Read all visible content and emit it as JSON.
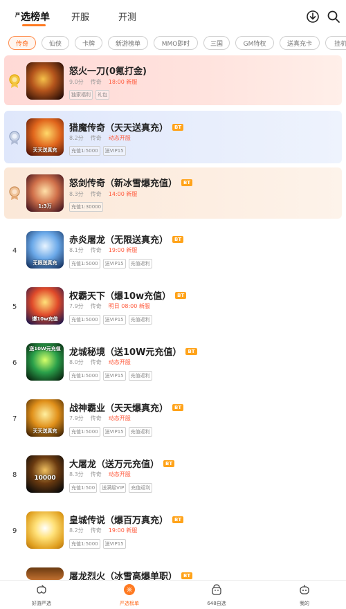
{
  "top_tabs": [
    {
      "sup": "严",
      "label": "选榜单"
    },
    {
      "label": "开服"
    },
    {
      "label": "开测"
    }
  ],
  "chips": [
    "传奇",
    "仙侠",
    "卡牌",
    "新游榜单",
    "MMO即时",
    "三国",
    "GM特权",
    "送真充卡",
    "挂机"
  ],
  "games": [
    {
      "rank": "",
      "title": "怒火一刀(0氪打金)",
      "bt": "",
      "score": "9.0分",
      "category": "传奇",
      "time": "18:00 新服",
      "tags": [
        "独家福利",
        "礼包"
      ],
      "thumb_text": ""
    },
    {
      "rank": "",
      "title": "猎魔传奇（天天送真充）",
      "bt": "BT",
      "score": "8.2分",
      "category": "传奇",
      "time": "动态开服",
      "tags": [
        "充值1:5000",
        "送VIP15"
      ],
      "thumb_text": "天天送真充"
    },
    {
      "rank": "",
      "title": "怒剑传奇（新冰雪爆充值）",
      "bt": "BT",
      "score": "8.3分",
      "category": "传奇",
      "time": "14:00 新服",
      "tags": [
        "充值1:30000"
      ],
      "thumb_text": "1:3万"
    },
    {
      "rank": "4",
      "title": "赤炎屠龙（无限送真充）",
      "bt": "BT",
      "score": "8.1分",
      "category": "传奇",
      "time": "19:00 新服",
      "tags": [
        "充值1:5000",
        "送VIP15",
        "充值返利"
      ],
      "thumb_text": "无限送真充"
    },
    {
      "rank": "5",
      "title": "权霸天下（爆10w充值）",
      "bt": "BT",
      "score": "7.9分",
      "category": "传奇",
      "time": "明日 08:00 新服",
      "tags": [
        "充值1:5000",
        "送VIP15",
        "充值返利"
      ],
      "thumb_text": "爆10w充值"
    },
    {
      "rank": "6",
      "title": "龙城秘境（送10W元充值）",
      "bt": "BT",
      "score": "8.0分",
      "category": "传奇",
      "time": "动态开服",
      "tags": [
        "充值1:5000",
        "送VIP15",
        "充值返利"
      ],
      "thumb_text": "送10W元充值"
    },
    {
      "rank": "7",
      "title": "战神霸业（天天爆真充）",
      "bt": "BT",
      "score": "7.9分",
      "category": "传奇",
      "time": "动态开服",
      "tags": [
        "充值1:5000",
        "送VIP15",
        "充值返利"
      ],
      "thumb_text": "天天送真充"
    },
    {
      "rank": "8",
      "title": "大屠龙（送万元充值）",
      "bt": "BT",
      "score": "8.3分",
      "category": "传奇",
      "time": "动态开服",
      "tags": [
        "充值1:500",
        "送满级VIP",
        "充值返利"
      ],
      "thumb_text": "10000"
    },
    {
      "rank": "9",
      "title": "皇城传说（爆百万真充）",
      "bt": "BT",
      "score": "8.2分",
      "category": "传奇",
      "time": "19:00 新服",
      "tags": [
        "充值1:5000",
        "送VIP15"
      ],
      "thumb_text": ""
    },
    {
      "rank": "",
      "title": "屠龙烈火（冰雪高爆单职）",
      "bt": "BT",
      "score": "",
      "category": "",
      "time": "",
      "tags": [],
      "thumb_text": ""
    }
  ],
  "bottom_nav": [
    {
      "label": "好游严选",
      "icon": "game-controller-icon"
    },
    {
      "label": "严选榜单",
      "icon": "ranking-icon"
    },
    {
      "label": "648自选",
      "icon": "gift-bag-icon"
    },
    {
      "label": "我的",
      "icon": "profile-icon"
    }
  ],
  "colors": {
    "accent": "#ff7a21",
    "bt_badge": "#ffa31a",
    "time_red": "#ff5a3c"
  }
}
